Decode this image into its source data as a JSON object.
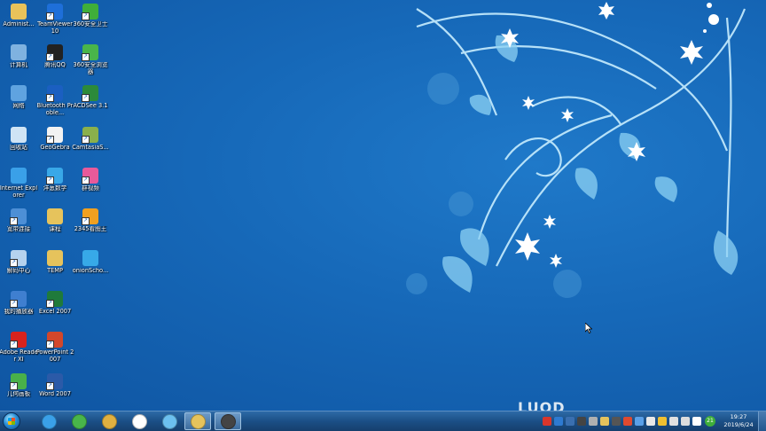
{
  "desktop": {
    "icons": [
      {
        "label": "Administ...",
        "icon": "folder-user-icon",
        "color": "#e8c25a",
        "shortcut": false
      },
      {
        "label": "计算机",
        "icon": "computer-icon",
        "color": "#7fb2e0",
        "shortcut": false
      },
      {
        "label": "网络",
        "icon": "network-icon",
        "color": "#5fa3e0",
        "shortcut": false
      },
      {
        "label": "回收站",
        "icon": "recycle-bin-icon",
        "color": "#cfe4f5",
        "shortcut": false
      },
      {
        "label": "Internet Explorer",
        "icon": "internet-explorer-icon",
        "color": "#3aa0e8",
        "shortcut": false
      },
      {
        "label": "宽带连接",
        "icon": "broadband-connection-icon",
        "color": "#4d8fd6",
        "shortcut": true
      },
      {
        "label": "解码中心",
        "icon": "decoder-center-icon",
        "color": "#b5d2ee",
        "shortcut": true
      },
      {
        "label": "我的播放器",
        "icon": "media-player-icon",
        "color": "#3f7fd0",
        "shortcut": true
      },
      {
        "label": "Adobe Reader XI",
        "icon": "adobe-reader-icon",
        "color": "#d8231e",
        "shortcut": true
      },
      {
        "label": "几何画板",
        "icon": "geometers-sketchpad-icon",
        "color": "#49b04a",
        "shortcut": true
      },
      {
        "label": "TeamViewer 10",
        "icon": "teamviewer-icon",
        "color": "#1e6fd9",
        "shortcut": true
      },
      {
        "label": "腾讯QQ",
        "icon": "qq-icon",
        "color": "#222222",
        "shortcut": true
      },
      {
        "label": "Bluetooth Proble...",
        "icon": "bluetooth-icon",
        "color": "#1b5fc1",
        "shortcut": true
      },
      {
        "label": "GeoGebra",
        "icon": "geogebra-icon",
        "color": "#f2f2f2",
        "shortcut": true
      },
      {
        "label": "洋葱数学",
        "icon": "yangcong-math-icon",
        "color": "#39a8e8",
        "shortcut": true
      },
      {
        "label": "课程",
        "icon": "folder-icon",
        "color": "#e6c35c",
        "shortcut": false
      },
      {
        "label": "TEMP",
        "icon": "folder-icon",
        "color": "#e6c35c",
        "shortcut": false
      },
      {
        "label": "Excel 2007",
        "icon": "excel-icon",
        "color": "#1f7a3b",
        "shortcut": true
      },
      {
        "label": "PowerPoint 2007",
        "icon": "powerpoint-icon",
        "color": "#d2472b",
        "shortcut": true
      },
      {
        "label": "Word 2007",
        "icon": "word-icon",
        "color": "#2b5aa8",
        "shortcut": true
      },
      {
        "label": "360安全卫士",
        "icon": "360-security-icon",
        "color": "#3fae3a",
        "shortcut": true
      },
      {
        "label": "360安全浏览器",
        "icon": "360-browser-icon",
        "color": "#49b54a",
        "shortcut": true
      },
      {
        "label": "ACDSee 3.1",
        "icon": "acdsee-icon",
        "color": "#2c8a3a",
        "shortcut": true
      },
      {
        "label": "CamtasiaS...",
        "icon": "camtasia-icon",
        "color": "#8ab04c",
        "shortcut": true
      },
      {
        "label": "群视频",
        "icon": "group-video-icon",
        "color": "#e85a9a",
        "shortcut": true
      },
      {
        "label": "2345看图王",
        "icon": "2345-image-viewer-icon",
        "color": "#f0a020",
        "shortcut": true
      },
      {
        "label": "onionScho...",
        "icon": "onion-school-icon",
        "color": "#37a9e8",
        "shortcut": false
      }
    ]
  },
  "watermark": {
    "text": "LUOD"
  },
  "taskbar": {
    "pinned": [
      {
        "name": "taskbar-ie",
        "icon": "internet-explorer-icon",
        "color": "#3aa0e8"
      },
      {
        "name": "taskbar-360-browser",
        "icon": "360-browser-icon",
        "color": "#49b54a"
      },
      {
        "name": "taskbar-brush",
        "icon": "brush-icon",
        "color": "#e0b040"
      },
      {
        "name": "taskbar-baidu-cloud",
        "icon": "cloud-icon",
        "color": "#ffffff"
      },
      {
        "name": "taskbar-network-app",
        "icon": "globe-icon",
        "color": "#6cc0f0"
      },
      {
        "name": "taskbar-explorer",
        "icon": "folder-icon",
        "color": "#e6c35c"
      },
      {
        "name": "taskbar-camera",
        "icon": "camera-icon",
        "color": "#444444"
      }
    ],
    "tray_icons": [
      "sogou-input-icon",
      "help-icon",
      "user-icon",
      "camera-icon",
      "settings-icon",
      "folder-icon",
      "video-icon",
      "flag-icon",
      "bluetooth-icon",
      "speaker-icon",
      "clean-icon",
      "notification-icon",
      "network-signal-icon",
      "volume-icon"
    ],
    "tray_badge": "21",
    "clock": {
      "time": "19:27",
      "date": "2019/6/24"
    }
  }
}
